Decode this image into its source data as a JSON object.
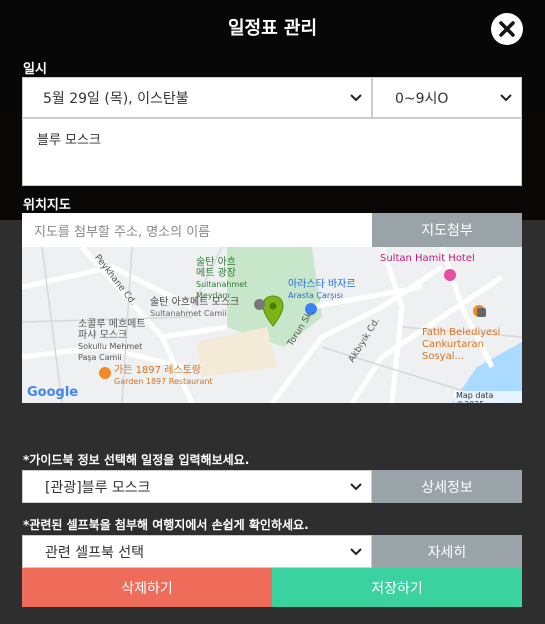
{
  "header": {
    "title": "일정표 관리"
  },
  "schedule": {
    "label": "일시",
    "date_value": "5월 29일 (목), 이스탄불",
    "time_value": "0~9시O"
  },
  "memo": {
    "text": "블루 모스크"
  },
  "location": {
    "label": "위치지도",
    "placeholder": "지도를 첨부할 주소, 명소의 이름",
    "attach_label": "지도첨부"
  },
  "map": {
    "labels": {
      "square_kr": "술탄 아흐",
      "square_kr2": "메트 광장",
      "square_en": "Sultanahmet",
      "square_en2": "Meydanı",
      "mosque_kr": "술탄 아흐메트 모스크",
      "mosque_en": "Sultanahmet Camii",
      "bazaar_kr": "아라스타 바자르",
      "bazaar_en": "Arasta Çarşısı",
      "hotel": "Sultan Hamit Hotel",
      "sokullu_kr": "소콜루 메흐메트",
      "sokullu_kr2": "파샤 모스크",
      "sokullu_en": "Sokullu Mehmet",
      "sokullu_en2": "Paşa Camii",
      "garden_kr": "가든 1897 레스토랑",
      "garden_en": "Garden 1897 Restaurant",
      "fatih1": "Fatih Belediyesi",
      "fatih2": "Cankurtaran Sosyal...",
      "street1": "Peykhane Cd.",
      "street2": "Torun Sk.",
      "street3": "Akbıyık Cd.",
      "google": "Google",
      "copyright": "Map data ©2025"
    },
    "colors": {
      "park": "#c8e6c9",
      "water": "#aadaff",
      "pin": "#7cb518"
    }
  },
  "guidebook": {
    "label": "*가이드북 정보 선택해 일정을 입력해보세요.",
    "selected": "[관광]블루 모스크",
    "detail_label": "상세정보"
  },
  "selfbook": {
    "label": "*관련된 셀프북을 첨부해 여행지에서 손쉽게 확인하세요.",
    "selected": "관련 셀프북 선택",
    "detail_label": "자세히"
  },
  "actions": {
    "delete_label": "삭제하기",
    "save_label": "저장하기",
    "delete_color": "#ef6c5b",
    "save_color": "#3ad29f"
  }
}
